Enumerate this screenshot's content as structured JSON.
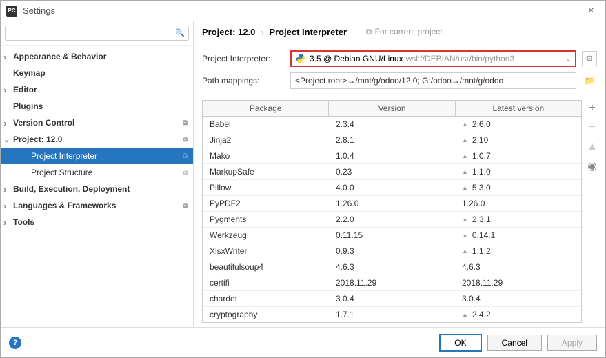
{
  "window": {
    "title": "Settings"
  },
  "search": {
    "placeholder": ""
  },
  "sidebar": {
    "items": [
      {
        "label": "Appearance & Behavior",
        "bold": true,
        "arrow": "collapsed"
      },
      {
        "label": "Keymap",
        "bold": true,
        "arrow": ""
      },
      {
        "label": "Editor",
        "bold": true,
        "arrow": "collapsed"
      },
      {
        "label": "Plugins",
        "bold": true,
        "arrow": ""
      },
      {
        "label": "Version Control",
        "bold": true,
        "arrow": "collapsed",
        "copy": true
      },
      {
        "label": "Project: 12.0",
        "bold": true,
        "arrow": "expanded",
        "copy": true
      },
      {
        "label": "Project Interpreter",
        "bold": false,
        "child": true,
        "selected": true,
        "copy": true
      },
      {
        "label": "Project Structure",
        "bold": false,
        "child": true,
        "copy": true
      },
      {
        "label": "Build, Execution, Deployment",
        "bold": true,
        "arrow": "collapsed"
      },
      {
        "label": "Languages & Frameworks",
        "bold": true,
        "arrow": "collapsed",
        "copy": true
      },
      {
        "label": "Tools",
        "bold": true,
        "arrow": "collapsed"
      }
    ]
  },
  "breadcrumb": {
    "root": "Project: 12.0",
    "leaf": "Project Interpreter",
    "hint": "For current project"
  },
  "form": {
    "interpreter_label": "Project Interpreter:",
    "interpreter_value_main": "3.5 @ Debian GNU/Linux",
    "interpreter_value_dim": "wsl://DEBIAN/usr/bin/python3",
    "path_label": "Path mappings:",
    "path_value": "<Project root>→/mnt/g/odoo/12.0; G:/odoo→/mnt/g/odoo"
  },
  "table": {
    "headers": {
      "package": "Package",
      "version": "Version",
      "latest": "Latest version"
    },
    "rows": [
      {
        "package": "Babel",
        "version": "2.3.4",
        "latest": "2.6.0",
        "upgrade": true
      },
      {
        "package": "Jinja2",
        "version": "2.8.1",
        "latest": "2.10",
        "upgrade": true
      },
      {
        "package": "Mako",
        "version": "1.0.4",
        "latest": "1.0.7",
        "upgrade": true
      },
      {
        "package": "MarkupSafe",
        "version": "0.23",
        "latest": "1.1.0",
        "upgrade": true
      },
      {
        "package": "Pillow",
        "version": "4.0.0",
        "latest": "5.3.0",
        "upgrade": true
      },
      {
        "package": "PyPDF2",
        "version": "1.26.0",
        "latest": "1.26.0",
        "upgrade": false
      },
      {
        "package": "Pygments",
        "version": "2.2.0",
        "latest": "2.3.1",
        "upgrade": true
      },
      {
        "package": "Werkzeug",
        "version": "0.11.15",
        "latest": "0.14.1",
        "upgrade": true
      },
      {
        "package": "XlsxWriter",
        "version": "0.9.3",
        "latest": "1.1.2",
        "upgrade": true
      },
      {
        "package": "beautifulsoup4",
        "version": "4.6.3",
        "latest": "4.6.3",
        "upgrade": false
      },
      {
        "package": "certifi",
        "version": "2018.11.29",
        "latest": "2018.11.29",
        "upgrade": false
      },
      {
        "package": "chardet",
        "version": "3.0.4",
        "latest": "3.0.4",
        "upgrade": false
      },
      {
        "package": "cryptography",
        "version": "1.7.1",
        "latest": "2.4.2",
        "upgrade": true
      }
    ]
  },
  "footer": {
    "ok": "OK",
    "cancel": "Cancel",
    "apply": "Apply"
  }
}
